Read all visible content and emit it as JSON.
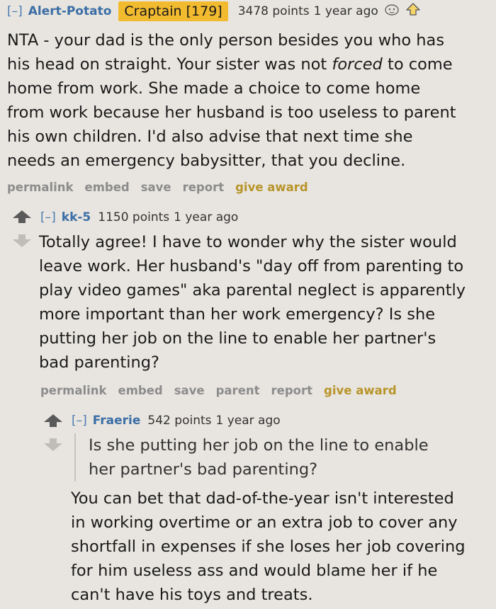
{
  "comments": [
    {
      "toggle": "[–]",
      "author": "Alert-Potato",
      "flair": "Craptain [179]",
      "points": "3478 points",
      "age": "1 year ago",
      "body": [
        "NTA - your dad is the only person besides you who has",
        "his head on straight. Your sister was not ",
        "forced",
        " to come",
        "home from work. She made a choice to come home",
        "from work because her husband is too useless to parent",
        "his own children. I'd also advise that next time she",
        "needs an emergency babysitter, that you decline."
      ],
      "actions": [
        "permalink",
        "embed",
        "save",
        "report",
        "give award"
      ]
    },
    {
      "toggle": "[–]",
      "author": "kk-5",
      "points": "1150 points",
      "age": "1 year ago",
      "body": [
        "Totally agree! I have to wonder why the sister would",
        "leave work. Her husband's \"day off from parenting to",
        "play video games\" aka parental neglect is apparently",
        "more important than her work emergency? Is she",
        "putting her job on the line to enable her partner's",
        "bad parenting?"
      ],
      "actions": [
        "permalink",
        "embed",
        "save",
        "parent",
        "report",
        "give award"
      ]
    },
    {
      "toggle": "[–]",
      "author": "Fraerie",
      "points": "542 points",
      "age": "1 year ago",
      "quote": [
        "Is she putting her job on the line to enable",
        "her partner's bad parenting?"
      ],
      "body": [
        "You can bet that dad-of-the-year isn't interested",
        "in working overtime or an extra job to cover any",
        "shortfall in expenses if she loses her job covering",
        "for him useless ass and would blame her if he",
        "can't have his toys and treats."
      ]
    }
  ],
  "colors": {
    "background": "#e8e5e0",
    "author": "#3b6ea5",
    "flair": "#f2bb2f",
    "award": "#b8942a",
    "action": "#8c8c8c",
    "upvote": "#5a5a5a",
    "downvote": "#c0bcb6"
  },
  "icons": [
    "upvote-arrow-icon",
    "downvote-arrow-icon",
    "reddit-emoji-icon",
    "share-arrow-icon"
  ]
}
